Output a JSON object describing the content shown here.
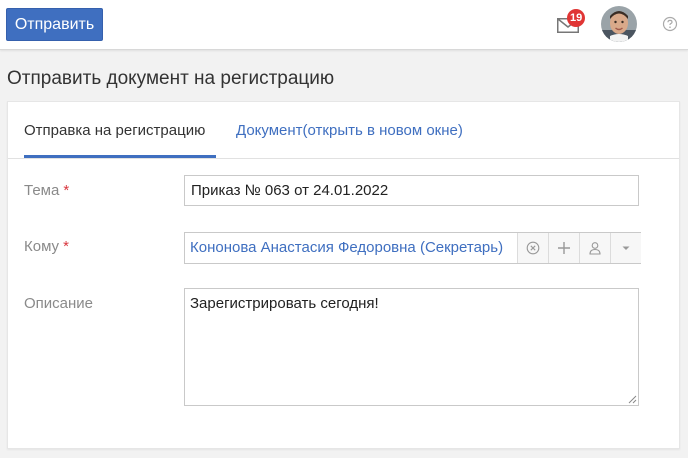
{
  "toolbar": {
    "send_label": "Отправить",
    "notifications_count": "19"
  },
  "page": {
    "title": "Отправить документ на регистрацию"
  },
  "tabs": [
    {
      "label": "Отправка на регистрацию",
      "active": true
    },
    {
      "label": "Документ(открыть в новом окне)",
      "active": false
    }
  ],
  "form": {
    "subject": {
      "label": "Тема",
      "required_mark": "*",
      "value": "Приказ № 063 от 24.01.2022"
    },
    "to": {
      "label": "Кому",
      "required_mark": "*",
      "value": "Кононова Анастасия Федоровна (Секретарь)"
    },
    "description": {
      "label": "Описание",
      "value": "Зарегистрировать сегодня!"
    }
  },
  "colors": {
    "accent": "#3f6fc0",
    "badge": "#e03534",
    "required": "#d9363e"
  },
  "icons": [
    "mail-icon",
    "avatar",
    "help-icon",
    "clear-icon",
    "plus-icon",
    "person-icon",
    "caret-down-icon",
    "resize-handle-icon"
  ]
}
